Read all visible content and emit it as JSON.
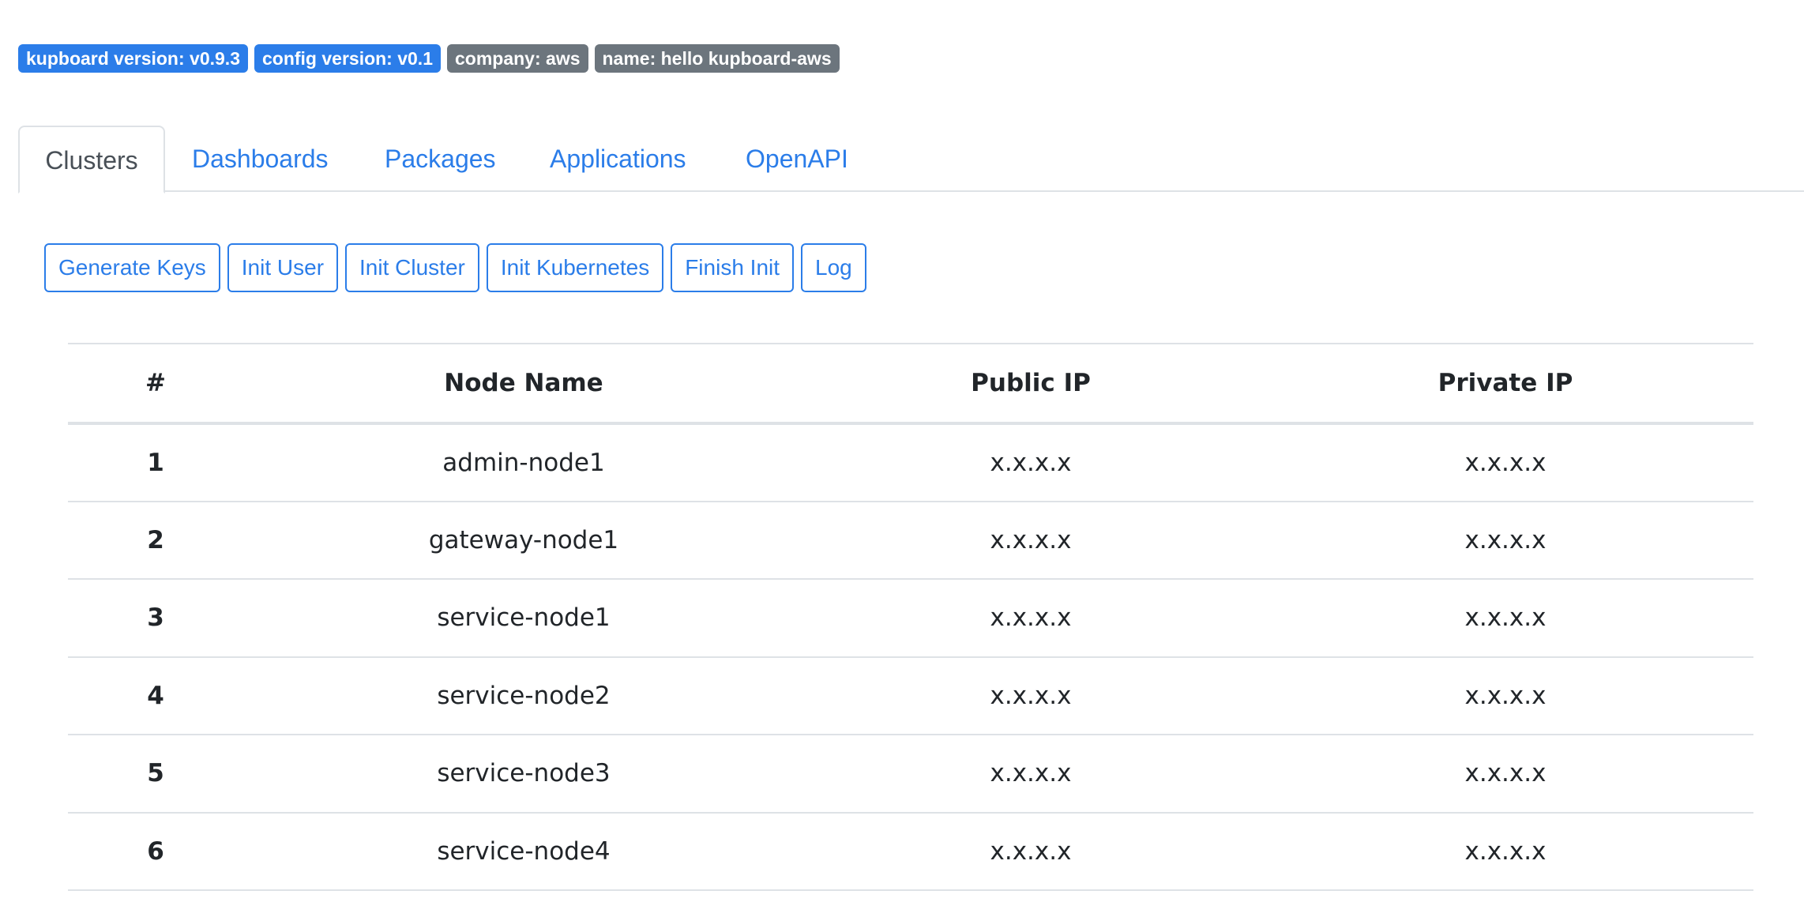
{
  "badges": [
    {
      "text": "kupboard version: v0.9.3",
      "color": "#2b7de9"
    },
    {
      "text": "config version: v0.1",
      "color": "#2b7de9"
    },
    {
      "text": "company: aws",
      "color": "#6c757d"
    },
    {
      "text": "name: hello kupboard-aws",
      "color": "#6c757d"
    }
  ],
  "tabs": [
    {
      "label": "Clusters",
      "active": true
    },
    {
      "label": "Dashboards",
      "active": false
    },
    {
      "label": "Packages",
      "active": false
    },
    {
      "label": "Applications",
      "active": false
    },
    {
      "label": "OpenAPI",
      "active": false
    }
  ],
  "actions": {
    "generate_keys": "Generate Keys",
    "init_user": "Init User",
    "init_cluster": "Init Cluster",
    "init_kubernetes": "Init Kubernetes",
    "finish_init": "Finish Init",
    "log": "Log"
  },
  "table": {
    "headers": [
      "#",
      "Node Name",
      "Public IP",
      "Private IP"
    ],
    "rows": [
      {
        "index": "1",
        "name": "admin-node1",
        "public_ip": "x.x.x.x",
        "private_ip": "x.x.x.x"
      },
      {
        "index": "2",
        "name": "gateway-node1",
        "public_ip": "x.x.x.x",
        "private_ip": "x.x.x.x"
      },
      {
        "index": "3",
        "name": "service-node1",
        "public_ip": "x.x.x.x",
        "private_ip": "x.x.x.x"
      },
      {
        "index": "4",
        "name": "service-node2",
        "public_ip": "x.x.x.x",
        "private_ip": "x.x.x.x"
      },
      {
        "index": "5",
        "name": "service-node3",
        "public_ip": "x.x.x.x",
        "private_ip": "x.x.x.x"
      },
      {
        "index": "6",
        "name": "service-node4",
        "public_ip": "x.x.x.x",
        "private_ip": "x.x.x.x"
      }
    ]
  },
  "colors": {
    "primary": "#2b7de9",
    "secondary": "#6c757d",
    "border": "#dee2e6",
    "text": "#212529"
  }
}
